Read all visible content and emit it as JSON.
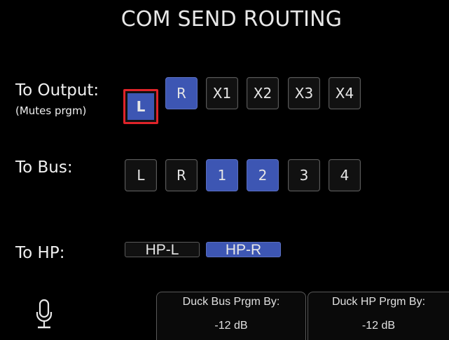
{
  "screen": {
    "title": "COM SEND ROUTING"
  },
  "output_row": {
    "label": "To Output:",
    "sublabel": "(Mutes prgm)",
    "buttons": [
      {
        "label": "L",
        "active": true,
        "focused": true
      },
      {
        "label": "R",
        "active": true,
        "focused": false
      },
      {
        "label": "X1",
        "active": false,
        "focused": false
      },
      {
        "label": "X2",
        "active": false,
        "focused": false
      },
      {
        "label": "X3",
        "active": false,
        "focused": false
      },
      {
        "label": "X4",
        "active": false,
        "focused": false
      }
    ]
  },
  "bus_row": {
    "label": "To Bus:",
    "buttons": [
      {
        "label": "L",
        "active": false
      },
      {
        "label": "R",
        "active": false
      },
      {
        "label": "1",
        "active": true
      },
      {
        "label": "2",
        "active": true
      },
      {
        "label": "3",
        "active": false
      },
      {
        "label": "4",
        "active": false
      }
    ]
  },
  "hp_row": {
    "label": "To HP:",
    "buttons": [
      {
        "label": "HP-L",
        "active": false
      },
      {
        "label": "HP-R",
        "active": true
      }
    ]
  },
  "footer": {
    "mic_icon": "microphone-icon",
    "duck_bus": {
      "label": "Duck Bus Prgm By:",
      "value": "-12 dB"
    },
    "duck_hp": {
      "label": "Duck HP Prgm By:",
      "value": "-12 dB"
    }
  },
  "colors": {
    "background": "#000000",
    "active_button": "#3d56b3",
    "focus_outline": "#e0242a",
    "inactive_button": "#111111",
    "text": "#e6e6e6"
  }
}
